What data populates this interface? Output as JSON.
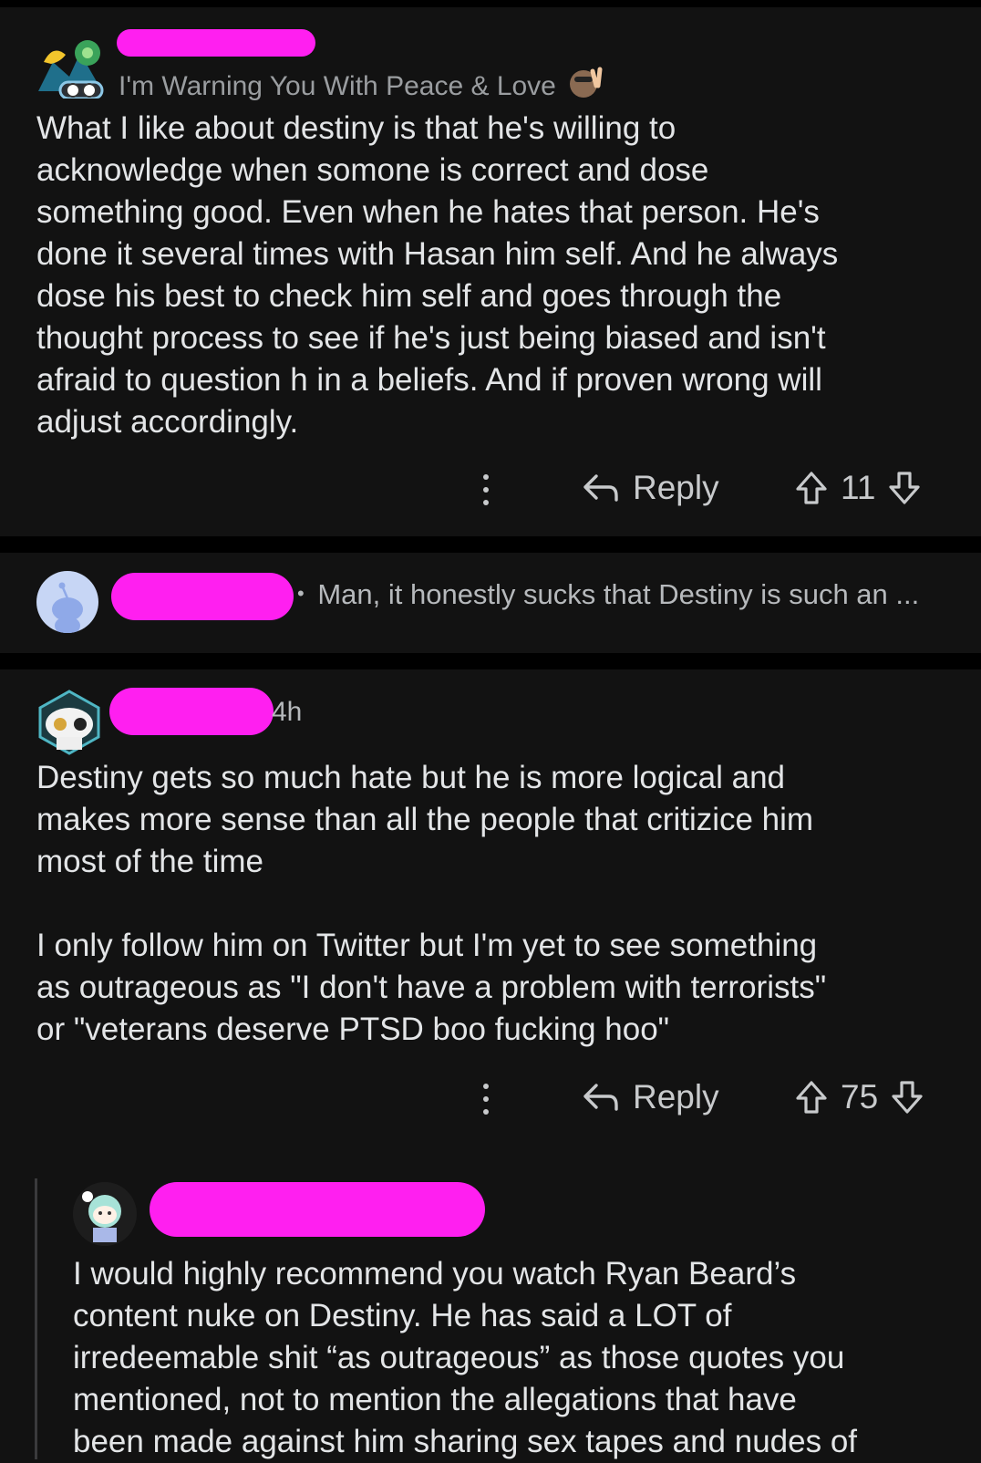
{
  "comment1": {
    "flair": "I'm Warning You With Peace & Love",
    "body": "What I like about destiny is that he's willing to\nacknowledge when somone is correct and dose\nsomething good. Even when he hates that person. He's\ndone it several times with Hasan him self. And he always\ndose his best to check him self and goes through the\nthought process to see if he's just being biased and isn't\nafraid to question h in a beliefs. And if proven wrong will\nadjust accordingly.",
    "reply_label": "Reply",
    "score": "11"
  },
  "collapsed": {
    "bullet": "•",
    "preview": "Man, it honestly sucks that Destiny is such an ..."
  },
  "comment2": {
    "time": "4h",
    "body": "Destiny gets so much hate but he is more logical and\nmakes more sense than all the people that critizice him\nmost of the time\n\nI only follow him on Twitter but I'm yet to see something\nas outrageous as \"I don't have a problem with terrorists\"\nor \"veterans deserve PTSD boo fucking hoo\"",
    "reply_label": "Reply",
    "score": "75"
  },
  "comment3": {
    "body": "I would highly recommend you watch Ryan Beard’s\ncontent nuke on Destiny. He has said a LOT of\nirredeemable shit “as outrageous” as those quotes you\nmentioned, not to mention the allegations that have\nbeen made against him sharing sex tapes and nudes of"
  },
  "icons": {
    "more": "more-options-icon",
    "reply": "reply-arrow-icon",
    "upvote": "upvote-icon",
    "downvote": "downvote-icon"
  },
  "colors": {
    "background": "#121212",
    "separator": "#000000",
    "redaction": "#ff1ff0",
    "text": "#e3e5e7",
    "muted": "#9a9da0"
  }
}
